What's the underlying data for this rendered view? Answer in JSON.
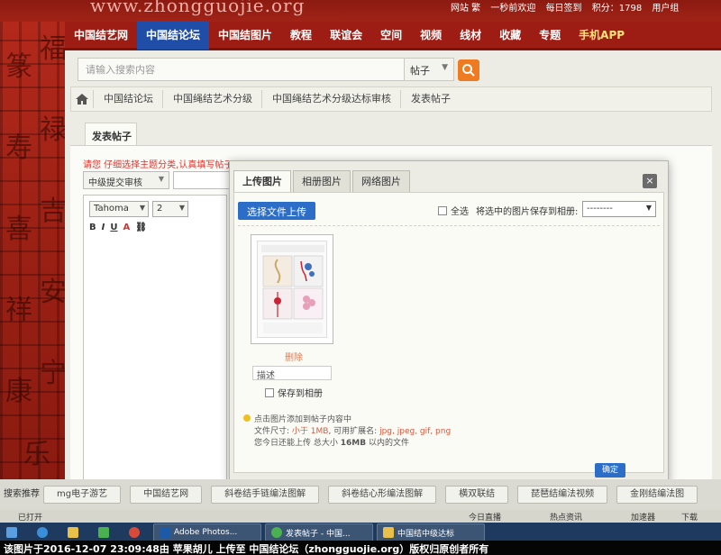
{
  "site": {
    "url_text": "www.zhongguojie.org",
    "top_info": [
      "网站 繁",
      "一秒前欢迎",
      "每日签到",
      "积分：1798",
      "用户组"
    ]
  },
  "nav": [
    "中国结艺网",
    "中国结论坛",
    "中国结图片",
    "教程",
    "联谊会",
    "空间",
    "视频",
    "线材",
    "收藏",
    "专题",
    "手机APP"
  ],
  "search": {
    "placeholder": "请输入搜索内容",
    "type": "帖子"
  },
  "breadcrumbs": [
    "中国结论坛",
    "中国绳结艺术分级",
    "中国绳结艺术分级达标审核",
    "发表帖子"
  ],
  "post": {
    "tab": "发表帖子",
    "warning": "请您 仔细选择主题分类,认真填写帖子",
    "category": "中级提交审核",
    "font": "Tahoma",
    "size": "2",
    "format_buttons": [
      "B",
      "I",
      "U",
      "A"
    ]
  },
  "modal": {
    "tabs": [
      "上传图片",
      "相册图片",
      "网络图片"
    ],
    "close": "×",
    "upload_button": "选择文件上传",
    "select_all": "全选",
    "save_selected_label": "将选中的图片保存到相册:",
    "album_value": "--------",
    "delete": "删除",
    "description_placeholder": "描述",
    "save_to_album": "保存到相册",
    "tips": {
      "line1": "点击图片添加到帖子内容中",
      "line2_prefix": "文件尺寸:",
      "line2_size": "小于 1MB",
      "line2_mid": ", 可用扩展名:",
      "line2_ext": "jpg, jpeg, gif, png",
      "line3_prefix": "您今日还能上传 总大小",
      "line3_size": "16MB",
      "line3_suffix": "以内的文件"
    },
    "confirm": "确定"
  },
  "tags": {
    "label": "搜索推荐",
    "items": [
      "mg电子游艺",
      "中国结艺网",
      "斜卷结手链编法图解",
      "斜卷结心形编法图解",
      "横双联结",
      "琵琶结编法视频",
      "金刚结编法图"
    ]
  },
  "statusbar": {
    "left": "已打开",
    "mid": "今日直播",
    "mid2": "热点资讯",
    "right1": "加速器",
    "right2": "下载"
  },
  "taskbar": [
    "Adobe Photos...",
    "发表帖子 - 中国...",
    "中国结中级达标"
  ],
  "caption": "该图片于2016-12-07 23:09:48由 苹果胡儿 上传至 中国结论坛（zhongguojie.org）版权归原创者所有"
}
